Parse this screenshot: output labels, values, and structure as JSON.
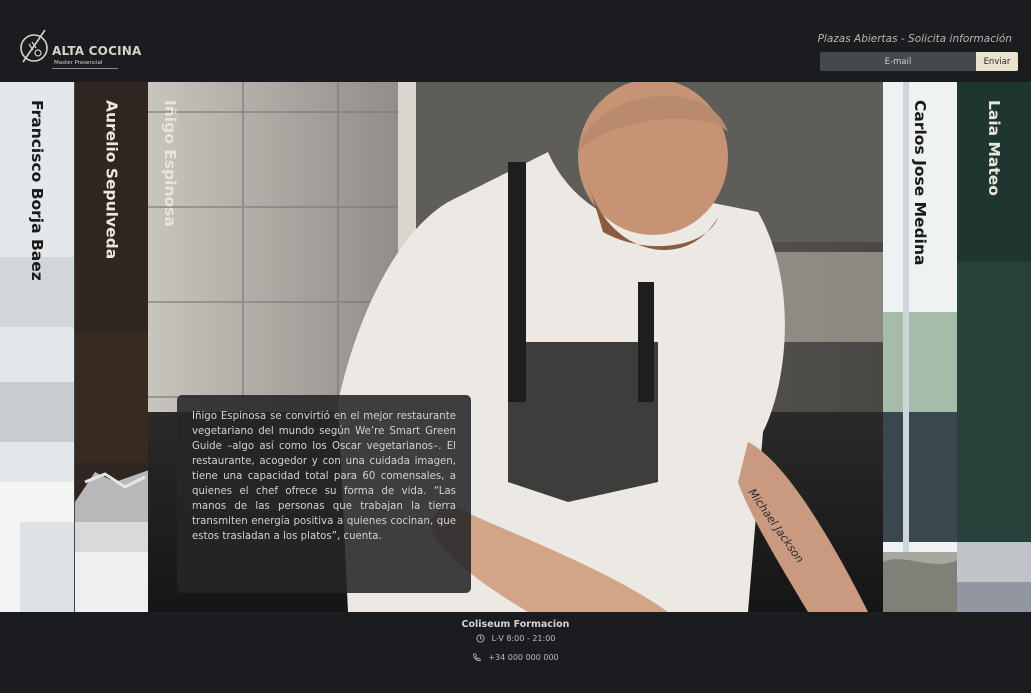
{
  "brand": {
    "name": "ALTA COCINA",
    "subtitle": "Master Presencial"
  },
  "header": {
    "link_text": "Plazas Abiertas - Solicita información",
    "email_placeholder": "E-mail",
    "send_label": "Enviar"
  },
  "chefs": [
    {
      "name": "Francisco Borja Baez"
    },
    {
      "name": "Aurelio Sepulveda"
    },
    {
      "name": "Iñigo Espinosa"
    },
    {
      "name": "Carlos Jose Medina"
    },
    {
      "name": "Laia Mateo"
    }
  ],
  "active_chef": {
    "bio": "Iñigo Espinosa se convirtió en el mejor restaurante vegetariano del mundo según We’re Smart Green Guide –algo así como los Oscar vegetarianos–. El restaurante, acogedor y con una cuidada imagen, tiene una capacidad total para 60 comensales, a quienes el chef ofrece su forma de vida. “Las manos de las personas que trabajan la tierra transmiten energía positiva a quienes cocinan, que estos trasladan a los platos”, cuenta."
  },
  "footer": {
    "name": "Coliseum Formacion",
    "hours": "L-V 8:00 - 21:00",
    "phone": "+34 000 000 000"
  }
}
